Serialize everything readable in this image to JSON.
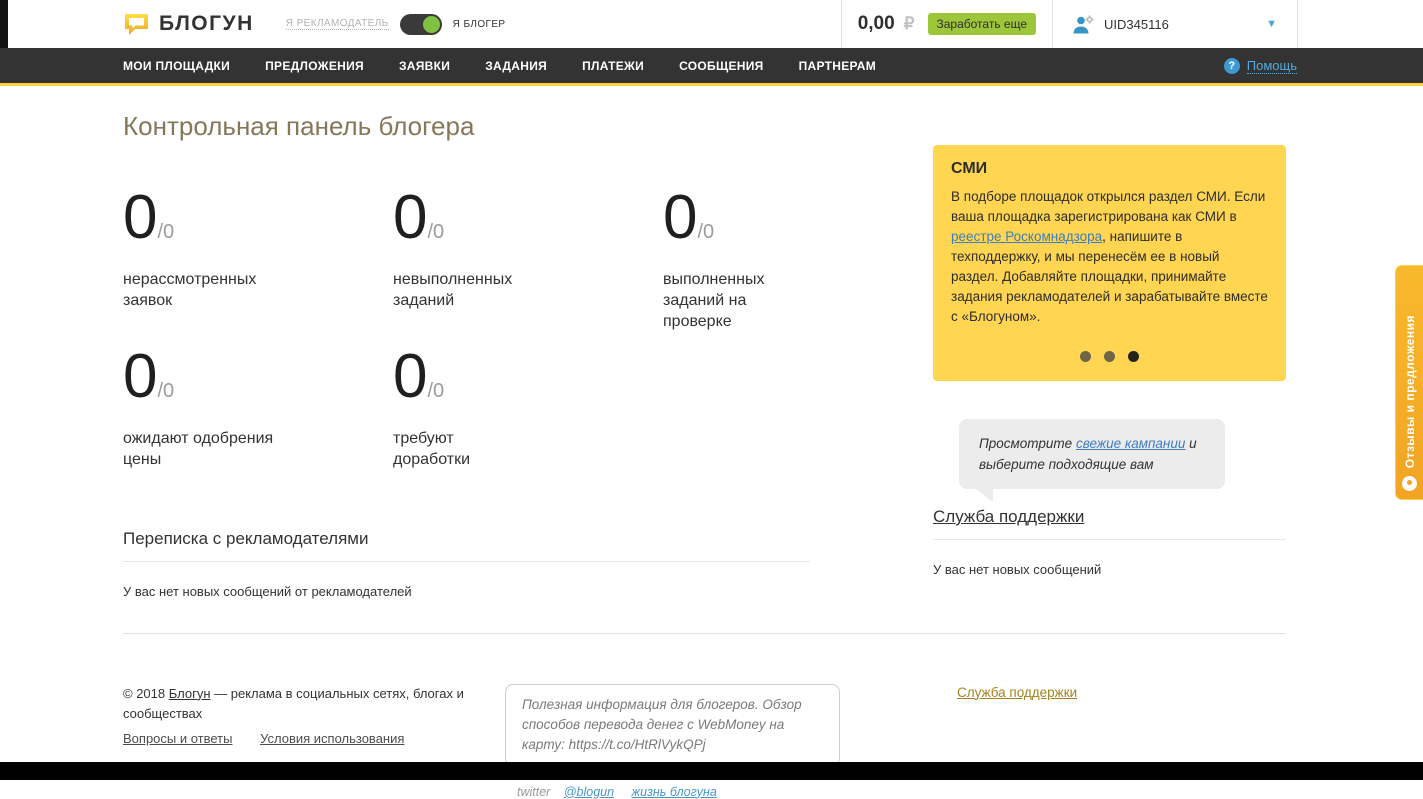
{
  "header": {
    "logo_text": "БЛОГУН",
    "role_toggle": {
      "advertiser_label": "Я РЕКЛАМОДАТЕЛЬ",
      "blogger_label": "Я БЛОГЕР",
      "state": "blogger"
    },
    "balance": {
      "amount": "0,00",
      "currency": "₽"
    },
    "earn_button_label": "Заработать еще",
    "user_id": "UID345116"
  },
  "nav": {
    "items": [
      "МОИ ПЛОЩАДКИ",
      "ПРЕДЛОЖЕНИЯ",
      "ЗАЯВКИ",
      "ЗАДАНИЯ",
      "ПЛАТЕЖИ",
      "СООБЩЕНИЯ",
      "ПАРТНЕРАМ"
    ],
    "help_label": "Помощь",
    "help_icon_glyph": "?"
  },
  "dashboard": {
    "title": "Контрольная панель блогера",
    "stats": [
      {
        "value": "0",
        "total": "/0",
        "label": "нерассмотренных заявок"
      },
      {
        "value": "0",
        "total": "/0",
        "label": "невыполненных заданий"
      },
      {
        "value": "0",
        "total": "/0",
        "label": "выполненных заданий на проверке"
      },
      {
        "value": "0",
        "total": "/0",
        "label": "ожидают одобрения цены"
      },
      {
        "value": "0",
        "total": "/0",
        "label": "требуют доработки"
      }
    ]
  },
  "smi_box": {
    "title": "СМИ",
    "text_before_link": "В подборе площадок открылся раздел СМИ. Если ваша площадка зарегистрирована как СМИ в ",
    "link_text": "реестре Роскомнадзора",
    "text_after_link": ", напишите в техподдержку, и мы перенесём ее в новый раздел. Добавляйте площадки, принимайте задания рекламодателей и зарабатывайте вместе с «Блогуном».",
    "carousel_dots_total": 3,
    "carousel_active_dot": 3
  },
  "campaign_bubble": {
    "text_before_link": "Просмотрите ",
    "link_text": "свежие кампании",
    "text_after_link": " и выберите подходящие вам"
  },
  "messages_section": {
    "title": "Переписка с рекламодателями",
    "empty_text": "У вас нет новых сообщений от рекламодателей"
  },
  "support_section": {
    "title": "Служба поддержки",
    "empty_text": "У вас нет новых сообщений"
  },
  "footer": {
    "copyright_prefix": "© 2018 ",
    "brand_link": "Блогун",
    "copyright_suffix": " — реклама в социальных сетях, блогах и сообществах",
    "faq_link": "Вопросы и ответы",
    "terms_link": "Условия использования",
    "tweet_text": "Полезная информация для блогеров. Обзор способов перевода денег с WebMoney на карту: https://t.co/HtRlVykQPj",
    "twitter_label": "twitter",
    "twitter_handle_link": "@blogun",
    "twitter_life_link": "жизнь блогуна",
    "support_link": "Служба поддержки"
  },
  "feedback_tab_label": "Отзывы и предложения",
  "colors": {
    "accent_yellow_box": "#ffd551",
    "nav_bar": "#333333",
    "nav_underline": "#fbd23b",
    "earn_button_green": "#9dc63b",
    "toggle_knob_green": "#7fc241",
    "link_blue": "#3d7dbf",
    "help_blue": "#54a9dc",
    "feedback_tab_orange": "#f2a423",
    "footer_support_gold": "#a3841c"
  }
}
